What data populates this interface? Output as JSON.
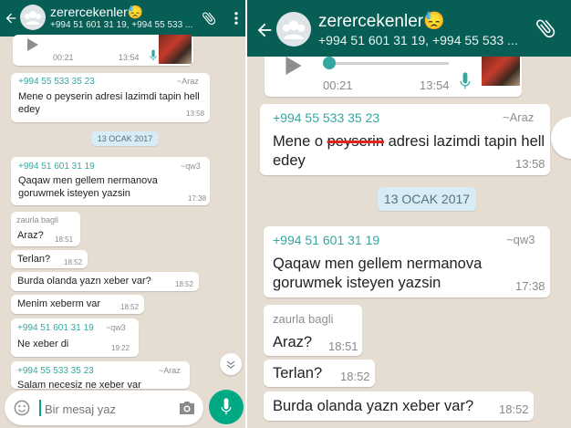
{
  "chat": {
    "title": "zerercekenler",
    "title_emoji": "😓",
    "subtitle": "+994 51 601 31 19, +994 55 533 ..."
  },
  "audio": {
    "elapsed": "00:21",
    "left_elapsed": "00:21",
    "duration": "13:54",
    "progress": 0.0
  },
  "messages": [
    {
      "sender": "+994 55 533 35 23",
      "name": "~Araz",
      "text_a": "Mene o ",
      "strike": "peyserin",
      "text_b": " adresi lazimdi tapin hell edey",
      "time": "13:58"
    },
    {
      "sender": "+994 51 601 31 19",
      "name": "~qw3",
      "text": "Qaqaw men gellem nermanova goruwmek isteyen yazsin",
      "time": "17:38"
    },
    {
      "sender": "zaurla bagli",
      "text": "Araz?",
      "time": "18:51"
    },
    {
      "text": "Terlan?",
      "time": "18:52"
    },
    {
      "text": "Burda olanda yazn xeber var?",
      "time": "18:52"
    },
    {
      "text": "Menim xeberm var",
      "time": "18:52"
    },
    {
      "sender": "+994 51 601 31 19",
      "name": "~qw3",
      "text": "Ne xeber di",
      "time": "19:22"
    },
    {
      "sender": "+994 55 533 35 23",
      "name": "~Araz",
      "text": "Salam necesiz ne xeber var"
    }
  ],
  "date_divider": "13 OCAK 2017",
  "composer": {
    "placeholder": "Bir mesaj yaz"
  },
  "colors": {
    "header": "#075e54",
    "accent": "#35a7a0",
    "mic": "#00a884"
  },
  "icons": [
    "back-arrow-icon",
    "group-avatar-icon",
    "paperclip-icon",
    "more-vert-icon",
    "play-icon",
    "mic-icon",
    "emoji-icon",
    "camera-icon",
    "chevron-down-icon"
  ]
}
